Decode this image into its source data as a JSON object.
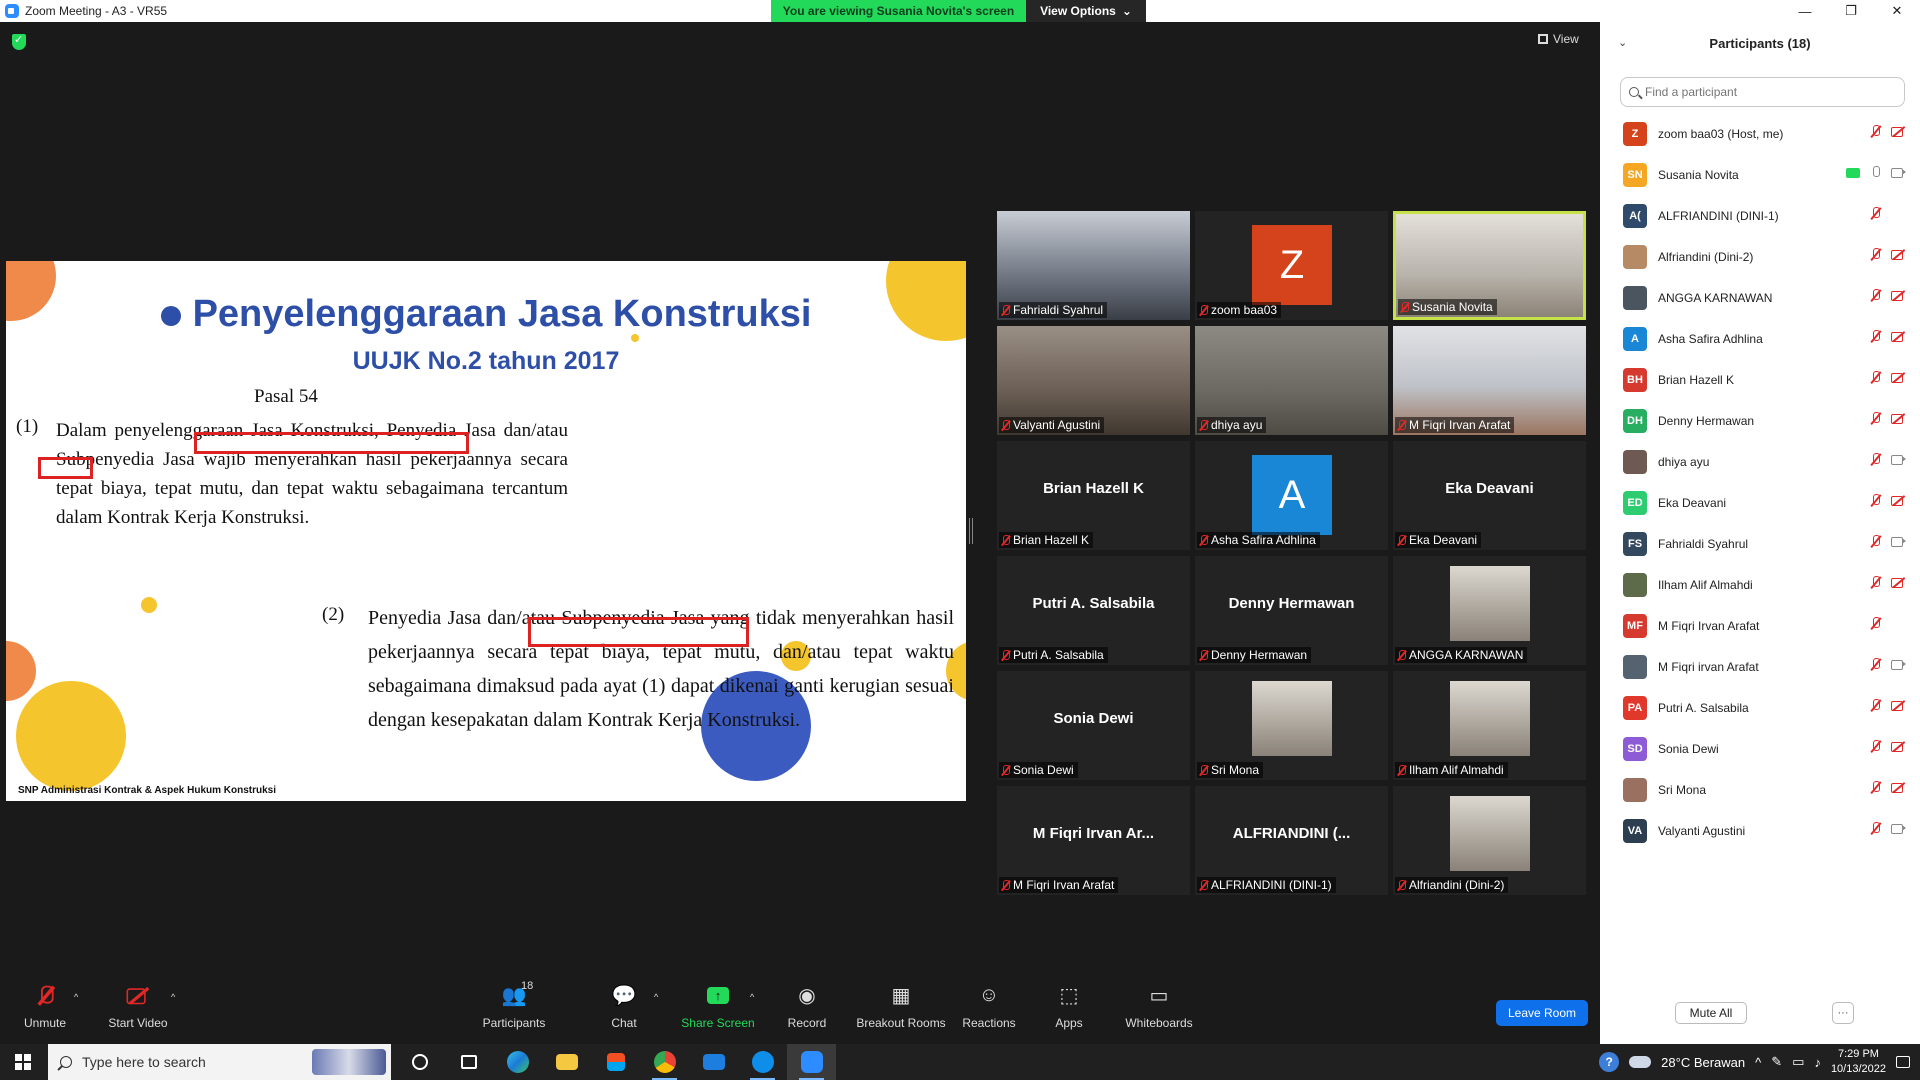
{
  "window": {
    "title": "Zoom Meeting - A3 - VR55",
    "minimize": "—",
    "maximize": "❐",
    "close": "✕"
  },
  "banner": {
    "viewing": "You are viewing Susania Novita's screen",
    "view_options": "View Options",
    "caret": "⌄"
  },
  "meeting": {
    "view_label": "View"
  },
  "slide": {
    "title": "Penyelenggaraan Jasa Konstruksi",
    "subtitle": "UUJK No.2 tahun 2017",
    "pasal": "Pasal 54",
    "ayat1_num": "(1)",
    "ayat1_text": "Dalam penyelenggaraan Jasa Konstruksi, Penyedia Jasa dan/atau Subpenyedia Jasa wajib menyerahkan hasil pekerjaannya secara tepat biaya, tepat mutu, dan tepat waktu sebagaimana tercantum dalam Kontrak Kerja Konstruksi.",
    "ayat2_num": "(2)",
    "ayat2_text": "Penyedia Jasa dan/atau Subpenyedia Jasa yang tidak menyerahkan hasil pekerjaannya secara tepat biaya, tepat mutu, dan/atau tepat waktu sebagaimana dimaksud pada ayat (1) dapat dikenai ganti kerugian sesuai dengan kesepakatan dalam Kontrak Kerja Konstruksi.",
    "footer": "SNP Administrasi Kontrak & Aspek Hukum Konstruksi"
  },
  "tiles": [
    {
      "label": "Fahrialdi Syahrul",
      "kind": "video"
    },
    {
      "label": "zoom baa03",
      "kind": "letter",
      "letter": "Z",
      "color": "#d4431b"
    },
    {
      "label": "Susania Novita",
      "kind": "video",
      "active": true
    },
    {
      "label": "Valyanti Agustini",
      "kind": "video"
    },
    {
      "label": "dhiya ayu",
      "kind": "video"
    },
    {
      "label": "M Fiqri Irvan Arafat",
      "kind": "video"
    },
    {
      "label": "Brian Hazell K",
      "kind": "name",
      "name": "Brian Hazell K"
    },
    {
      "label": "Asha Safira Adhlina",
      "kind": "letter",
      "letter": "A",
      "color": "#1a86d6"
    },
    {
      "label": "Eka Deavani",
      "kind": "name",
      "name": "Eka Deavani"
    },
    {
      "label": "Putri A. Salsabila",
      "kind": "name",
      "name": "Putri A. Salsabila"
    },
    {
      "label": "Denny Hermawan",
      "kind": "name",
      "name": "Denny Hermawan"
    },
    {
      "label": "ANGGA KARNAWAN",
      "kind": "photo"
    },
    {
      "label": "Sonia Dewi",
      "kind": "name",
      "name": "Sonia Dewi"
    },
    {
      "label": "Sri Mona",
      "kind": "photo"
    },
    {
      "label": "Ilham Alif Almahdi",
      "kind": "photo"
    },
    {
      "label": "M Fiqri Irvan Arafat",
      "kind": "name",
      "name": "M Fiqri Irvan Ar..."
    },
    {
      "label": "ALFRIANDINI (DINI-1)",
      "kind": "name",
      "name": "ALFRIANDINI (..."
    },
    {
      "label": "Alfriandini (Dini-2)",
      "kind": "photo"
    }
  ],
  "toolbar": {
    "unmute": "Unmute",
    "start_video": "Start Video",
    "participants": "Participants",
    "participants_count": "18",
    "chat": "Chat",
    "share_screen": "Share Screen",
    "record": "Record",
    "breakout": "Breakout Rooms",
    "reactions": "Reactions",
    "apps": "Apps",
    "whiteboards": "Whiteboards",
    "leave": "Leave Room",
    "caret": "^"
  },
  "panel": {
    "title": "Participants (18)",
    "collapse": "⌄",
    "search_placeholder": "Find a participant",
    "participants": [
      {
        "name": "zoom baa03 (Host, me)",
        "initials": "Z",
        "color": "#d4431b",
        "mic": "muted",
        "cam": "off"
      },
      {
        "name": "Susania Novita",
        "initials": "SN",
        "color": "#f5a623",
        "mic": "on",
        "cam": "on",
        "sharing": true
      },
      {
        "name": "ALFRIANDINI (DINI-1)",
        "initials": "A(",
        "color": "#2f4a6b",
        "mic": "muted",
        "cam": "none"
      },
      {
        "name": "Alfriandini (Dini-2)",
        "initials": "",
        "color": "#b58a64",
        "mic": "muted",
        "cam": "off"
      },
      {
        "name": "ANGGA KARNAWAN",
        "initials": "",
        "color": "#4a5560",
        "mic": "muted",
        "cam": "off"
      },
      {
        "name": "Asha Safira Adhlina",
        "initials": "A",
        "color": "#1a86d6",
        "mic": "muted",
        "cam": "off"
      },
      {
        "name": "Brian Hazell K",
        "initials": "BH",
        "color": "#d63a2f",
        "mic": "muted",
        "cam": "off"
      },
      {
        "name": "Denny Hermawan",
        "initials": "DH",
        "color": "#27ae60",
        "mic": "muted",
        "cam": "off"
      },
      {
        "name": "dhiya ayu",
        "initials": "",
        "color": "#6e5a52",
        "mic": "muted",
        "cam": "on"
      },
      {
        "name": "Eka Deavani",
        "initials": "ED",
        "color": "#2ecc71",
        "mic": "muted",
        "cam": "off"
      },
      {
        "name": "Fahrialdi Syahrul",
        "initials": "FS",
        "color": "#34495e",
        "mic": "muted",
        "cam": "on"
      },
      {
        "name": "Ilham Alif Almahdi",
        "initials": "",
        "color": "#5d6b4a",
        "mic": "muted",
        "cam": "off"
      },
      {
        "name": "M Fiqri Irvan Arafat",
        "initials": "MF",
        "color": "#d63a2f",
        "mic": "muted",
        "cam": "none"
      },
      {
        "name": "M Fiqri irvan Arafat",
        "initials": "",
        "color": "#556270",
        "mic": "muted",
        "cam": "on"
      },
      {
        "name": "Putri A. Salsabila",
        "initials": "PA",
        "color": "#e0392b",
        "mic": "muted",
        "cam": "off"
      },
      {
        "name": "Sonia Dewi",
        "initials": "SD",
        "color": "#8e5bd6",
        "mic": "muted",
        "cam": "off"
      },
      {
        "name": "Sri Mona",
        "initials": "",
        "color": "#9a7060",
        "mic": "muted",
        "cam": "off"
      },
      {
        "name": "Valyanti Agustini",
        "initials": "VA",
        "color": "#2c3e50",
        "mic": "muted",
        "cam": "on"
      }
    ],
    "mute_all": "Mute All",
    "more": "···"
  },
  "taskbar": {
    "search_placeholder": "Type here to search",
    "weather": "28°C  Berawan",
    "time": "7:29 PM",
    "date": "10/13/2022",
    "tray_caret": "^",
    "help": "?"
  }
}
